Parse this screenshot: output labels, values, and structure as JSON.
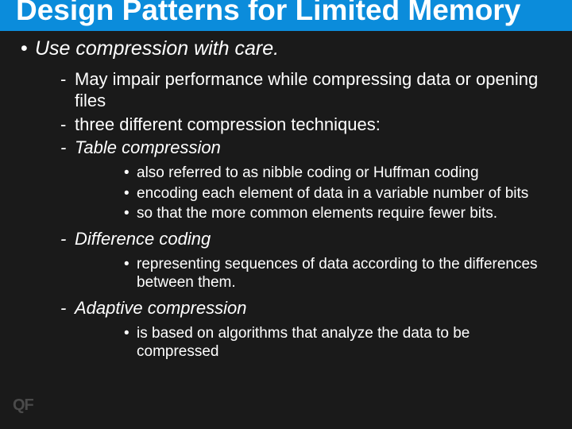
{
  "title": "Design Patterns for Limited Memory",
  "bullets": {
    "main": "Use compression with care.",
    "sub": [
      {
        "text": "May impair performance while compressing data or opening files",
        "italic": false
      },
      {
        "text": "three different compression techniques:",
        "italic": false
      },
      {
        "text": "Table compression",
        "italic": true
      }
    ],
    "table_details": [
      "also referred to as nibble coding or Huffman coding",
      "encoding each element of data in a variable number of bits",
      "so that the more common elements require fewer bits."
    ],
    "diff": {
      "text": "Difference coding",
      "italic": true
    },
    "diff_details": [
      "representing sequences of data according to the differences between them."
    ],
    "adaptive": {
      "text": "Adaptive compression",
      "italic": true
    },
    "adaptive_details": [
      "is based on algorithms that analyze the data to be compressed"
    ]
  },
  "logo": "QF"
}
